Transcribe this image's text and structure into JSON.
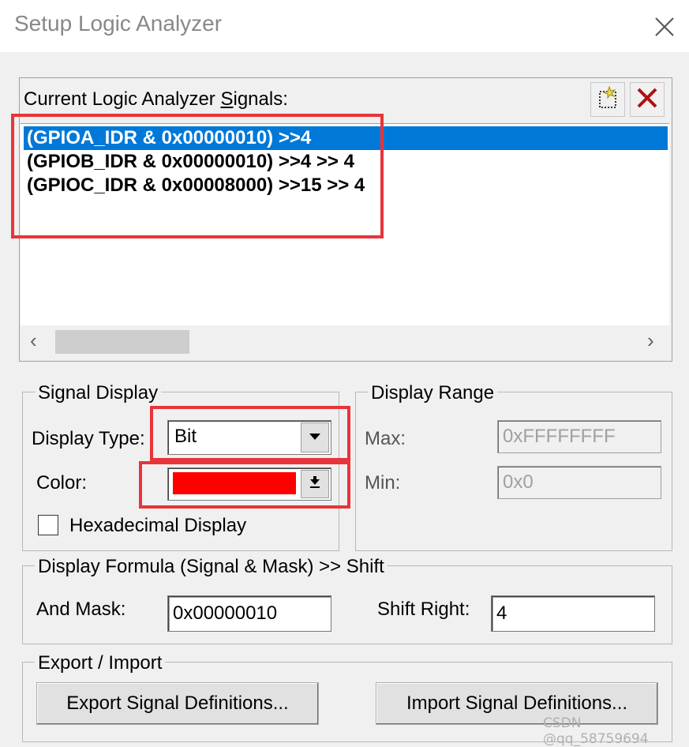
{
  "window": {
    "title": "Setup Logic Analyzer",
    "close_icon": "close-icon"
  },
  "signals": {
    "label_prefix": "Current Logic Analyzer ",
    "label_underlined": "S",
    "label_suffix": "ignals:",
    "new_icon": "new-signal-icon",
    "delete_icon": "delete-signal-icon",
    "items": [
      "(GPIOA_IDR & 0x00000010) >>4",
      "(GPIOB_IDR & 0x00000010) >>4 >> 4",
      "(GPIOC_IDR & 0x00008000) >>15 >> 4"
    ],
    "selected_index": 0
  },
  "signal_display": {
    "legend": "Signal Display",
    "display_type_label": "Display Type:",
    "display_type_value": "Bit",
    "color_label": "Color:",
    "color_value": "#ff0000",
    "hex_label": "Hexadecimal Display",
    "hex_checked": false
  },
  "display_range": {
    "legend": "Display Range",
    "max_label": "Max:",
    "max_value": "0xFFFFFFFF",
    "min_label": "Min:",
    "min_value": "0x0"
  },
  "formula": {
    "legend": "Display Formula (Signal & Mask) >> Shift",
    "and_mask_label": "And Mask:",
    "and_mask_value": "0x00000010",
    "shift_label": "Shift Right:",
    "shift_value": "4"
  },
  "export_import": {
    "legend": "Export / Import",
    "export_label": "Export Signal Definitions...",
    "import_label": "Import Signal Definitions..."
  },
  "watermark": "CSDN @qq_58759694",
  "colors": {
    "selection": "#0078d7",
    "annotation": "#e8343a"
  }
}
